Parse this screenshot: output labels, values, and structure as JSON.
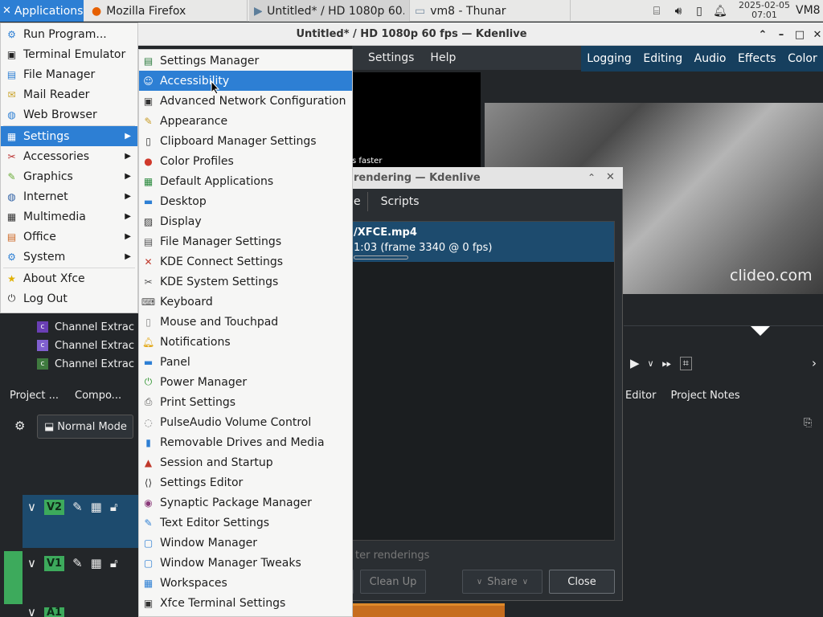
{
  "panel": {
    "apps_label": "Applications",
    "tasks": [
      {
        "label": "Mozilla Firefox",
        "icon": "firefox-icon"
      },
      {
        "label": "Untitled* / HD 1080p 60...",
        "icon": "kdenlive-icon"
      },
      {
        "label": "vm8 - Thunar",
        "icon": "folder-icon"
      }
    ],
    "clock_date": "2025-02-05",
    "clock_time": "07:01",
    "host": "VM8"
  },
  "kdenlive": {
    "title": "Untitled* / HD 1080p 60 fps — Kdenlive",
    "menu": [
      "Settings",
      "Help"
    ],
    "layouts": [
      "Logging",
      "Editing",
      "Audio",
      "Effects",
      "Color"
    ],
    "overlay_text": "s faster",
    "watermark": "clideo.com",
    "right_tabs": [
      "Editor",
      "Project Notes"
    ],
    "left_tabs": [
      "Project ...",
      "Compo..."
    ],
    "mode_label": "Normal Mode",
    "effects": [
      {
        "label": "Channel Extrac",
        "badge": "c",
        "color": "#6a3fb5"
      },
      {
        "label": "Channel Extrac",
        "badge": "c",
        "color": "#7a52c5"
      },
      {
        "label": "Channel Extrac",
        "badge": "c",
        "color": "#3f7a3f"
      }
    ],
    "tracks": [
      "V2",
      "V1",
      "A1"
    ]
  },
  "render_dialog": {
    "title": "rendering — Kdenlive",
    "tabs": [
      "e",
      "Scripts"
    ],
    "job_file": "/XFCE.mp4",
    "job_status": "1:03 (frame 3340 @ 0 fps)",
    "later_text": "ter renderings",
    "buttons": {
      "cleanup": "Clean Up",
      "share": "Share",
      "close": "Close"
    }
  },
  "app_menu": {
    "items": [
      {
        "label": "Run Program...",
        "icon": "run-icon",
        "sub": false
      },
      {
        "label": "Terminal Emulator",
        "icon": "terminal-icon",
        "sub": false
      },
      {
        "label": "File Manager",
        "icon": "file-manager-icon",
        "sub": false
      },
      {
        "label": "Mail Reader",
        "icon": "mail-icon",
        "sub": false
      },
      {
        "label": "Web Browser",
        "icon": "web-browser-icon",
        "sub": false
      },
      {
        "label": "Settings",
        "icon": "settings-icon",
        "sub": true
      },
      {
        "label": "Accessories",
        "icon": "accessories-icon",
        "sub": true
      },
      {
        "label": "Graphics",
        "icon": "graphics-icon",
        "sub": true
      },
      {
        "label": "Internet",
        "icon": "internet-icon",
        "sub": true
      },
      {
        "label": "Multimedia",
        "icon": "multimedia-icon",
        "sub": true
      },
      {
        "label": "Office",
        "icon": "office-icon",
        "sub": true
      },
      {
        "label": "System",
        "icon": "system-icon",
        "sub": true
      },
      {
        "label": "About Xfce",
        "icon": "about-icon",
        "sub": false
      },
      {
        "label": "Log Out",
        "icon": "logout-icon",
        "sub": false
      }
    ]
  },
  "settings_menu": {
    "items": [
      {
        "label": "Settings Manager",
        "icon": "settings-manager-icon"
      },
      {
        "label": "Accessibility",
        "icon": "accessibility-icon"
      },
      {
        "label": "Advanced Network Configuration",
        "icon": "network-icon"
      },
      {
        "label": "Appearance",
        "icon": "appearance-icon"
      },
      {
        "label": "Clipboard Manager Settings",
        "icon": "clipboard-icon"
      },
      {
        "label": "Color Profiles",
        "icon": "color-profiles-icon"
      },
      {
        "label": "Default Applications",
        "icon": "default-apps-icon"
      },
      {
        "label": "Desktop",
        "icon": "desktop-icon"
      },
      {
        "label": "Display",
        "icon": "display-icon"
      },
      {
        "label": "File Manager Settings",
        "icon": "file-manager-settings-icon"
      },
      {
        "label": "KDE Connect Settings",
        "icon": "kde-connect-icon"
      },
      {
        "label": "KDE System Settings",
        "icon": "kde-system-icon"
      },
      {
        "label": "Keyboard",
        "icon": "keyboard-icon"
      },
      {
        "label": "Mouse and Touchpad",
        "icon": "mouse-icon"
      },
      {
        "label": "Notifications",
        "icon": "notifications-icon"
      },
      {
        "label": "Panel",
        "icon": "panel-icon"
      },
      {
        "label": "Power Manager",
        "icon": "power-icon"
      },
      {
        "label": "Print Settings",
        "icon": "printer-icon"
      },
      {
        "label": "PulseAudio Volume Control",
        "icon": "volume-icon"
      },
      {
        "label": "Removable Drives and Media",
        "icon": "removable-drives-icon"
      },
      {
        "label": "Session and Startup",
        "icon": "session-icon"
      },
      {
        "label": "Settings Editor",
        "icon": "settings-editor-icon"
      },
      {
        "label": "Synaptic Package Manager",
        "icon": "synaptic-icon"
      },
      {
        "label": "Text Editor Settings",
        "icon": "text-editor-icon"
      },
      {
        "label": "Window Manager",
        "icon": "window-manager-icon"
      },
      {
        "label": "Window Manager Tweaks",
        "icon": "wm-tweaks-icon"
      },
      {
        "label": "Workspaces",
        "icon": "workspaces-icon"
      },
      {
        "label": "Xfce Terminal Settings",
        "icon": "xfce-terminal-icon"
      }
    ]
  }
}
